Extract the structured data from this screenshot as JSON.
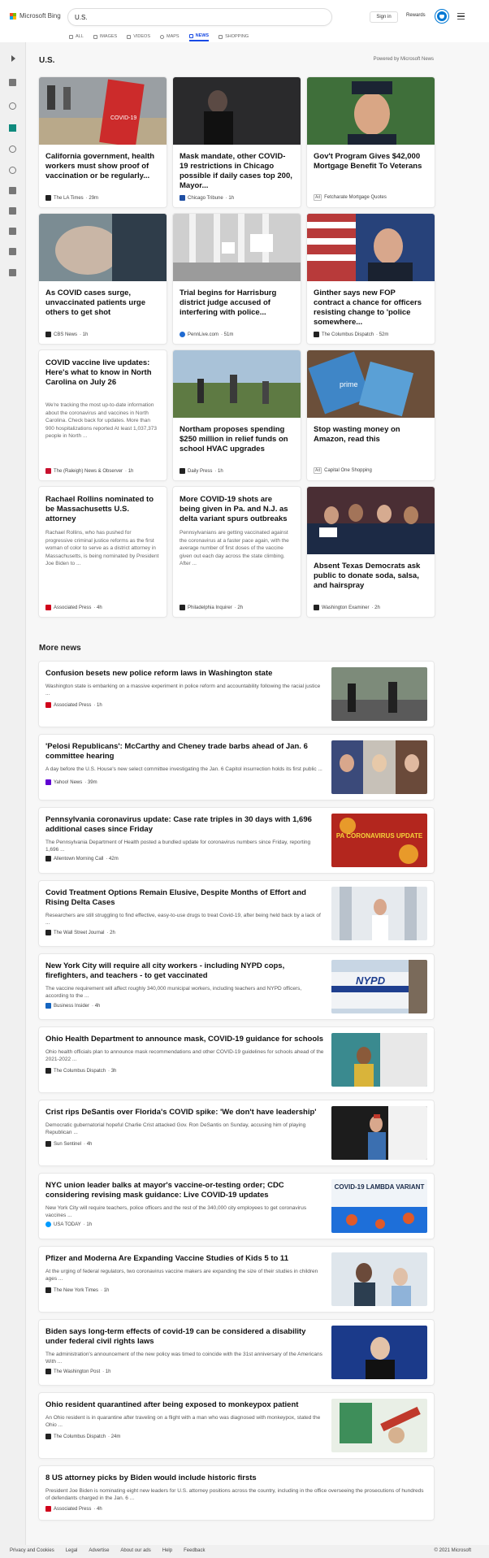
{
  "header": {
    "brand": "Microsoft Bing",
    "query": "U.S.",
    "signin": "Sign in",
    "rewards": "Rewards",
    "tabs": [
      {
        "label": "ALL",
        "icon": "search-icon"
      },
      {
        "label": "IMAGES",
        "icon": "image-icon"
      },
      {
        "label": "VIDEOS",
        "icon": "video-icon"
      },
      {
        "label": "MAPS",
        "icon": "map-pin-icon"
      },
      {
        "label": "NEWS",
        "icon": "news-icon",
        "active": true
      },
      {
        "label": "SHOPPING",
        "icon": "tag-icon"
      }
    ]
  },
  "section": {
    "title": "U.S.",
    "powered": "Powered by Microsoft News"
  },
  "cards": [
    {
      "title": "California government, health workers must show proof of vaccination or be regularly...",
      "source": "The LA Times",
      "time": "29m"
    },
    {
      "title": "Mask mandate, other COVID-19 restrictions in Chicago possible if daily cases top 200, Mayor...",
      "source": "Chicago Tribune",
      "time": "1h"
    },
    {
      "title": "Gov't Program Gives $42,000 Mortgage Benefit To Veterans",
      "source": "Fetcharate Mortgage Quotes",
      "ad": "Ad",
      "time": ""
    },
    {
      "title": "As COVID cases surge, unvaccinated patients urge others to get shot",
      "source": "CBS News",
      "time": "1h"
    },
    {
      "title": "Trial begins for Harrisburg district judge accused of interfering with police...",
      "source": "PennLive.com",
      "time": "51m"
    },
    {
      "title": "Ginther says new FOP contract a chance for officers resisting change to 'police somewhere...",
      "source": "The Columbus Dispatch",
      "time": "52m"
    },
    {
      "title": "COVID vaccine live updates: Here's what to know in North Carolina on July 26",
      "snippet": "We're tracking the most up-to-date information about the coronavirus and vaccines in North Carolina. Check back for updates. More than 900 hospitalizations reported At least 1,037,373 people in North ...",
      "source": "The (Raleigh) News & Observer",
      "time": "1h"
    },
    {
      "title": "Northam proposes spending $250 million in relief funds on school HVAC upgrades",
      "source": "Daily Press",
      "time": "1h"
    },
    {
      "title": "Stop wasting money on Amazon, read this",
      "source": "Capital One Shopping",
      "ad": "Ad",
      "time": ""
    },
    {
      "title": "Rachael Rollins nominated to be Massachusetts U.S. attorney",
      "snippet": "Rachael Rollins, who has pushed for progressive criminal justice reforms as the first woman of color to serve as a district attorney in Massachusetts, is being nominated by President Joe Biden to ...",
      "source": "Associated Press",
      "time": "4h"
    },
    {
      "title": "More COVID-19 shots are being given in Pa. and N.J. as delta variant spurs outbreaks",
      "snippet": "Pennsylvanians are getting vaccinated against the coronavirus at a faster pace again, with the average number of first doses of the vaccine given out each day across the state climbing. After ...",
      "source": "Philadelphia Inquirer",
      "time": "2h"
    },
    {
      "title": "Absent Texas Democrats ask public to donate soda, salsa, and hairspray",
      "source": "Washington Examiner",
      "time": "2h"
    }
  ],
  "more_news": {
    "title": "More news",
    "items": [
      {
        "title": "Confusion besets new police reform laws in Washington state",
        "snippet": "Washington state is embarking on a massive experiment in police reform and accountability following the racial justice ...",
        "source": "Associated Press",
        "time": "1h"
      },
      {
        "title": "'Pelosi Republicans': McCarthy and Cheney trade barbs ahead of Jan. 6 committee hearing",
        "snippet": "A day before the U.S. House's new select committee investigating the Jan. 6 Capitol insurrection holds its first public ...",
        "source": "Yahoo! News",
        "time": "39m"
      },
      {
        "title": "Pennsylvania coronavirus update: Case rate triples in 30 days with 1,696 additional cases since Friday",
        "snippet": "The Pennsylvania Department of Health posted a bundled update for coronavirus numbers since Friday, reporting 1,696 ...",
        "source": "Allentown Morning Call",
        "time": "42m",
        "img_text": "PA CORONAVIRUS UPDATE"
      },
      {
        "title": "Covid Treatment Options Remain Elusive, Despite Months of Effort and Rising Delta Cases",
        "snippet": "Researchers are still struggling to find effective, easy-to-use drugs to treat Covid-19, after being held back by a lack of ...",
        "source": "The Wall Street Journal",
        "time": "2h"
      },
      {
        "title": "New York City will require all city workers - including NYPD cops, firefighters, and teachers - to get vaccinated",
        "snippet": "The vaccine requirement will affect roughly 340,000 municipal workers, including teachers and NYPD officers, according to the ...",
        "source": "Business Insider",
        "time": "4h",
        "img_text": "NYPD"
      },
      {
        "title": "Ohio Health Department to announce mask, COVID-19 guidance for schools",
        "snippet": "Ohio health officials plan to announce mask recommendations and other COVID-19 guidelines for schools ahead of the 2021-2022 ...",
        "source": "The Columbus Dispatch",
        "time": "3h"
      },
      {
        "title": "Crist rips DeSantis over Florida's COVID spike: 'We don't have leadership'",
        "snippet": "Democratic gubernatorial hopeful Charlie Crist attacked Gov. Ron DeSantis on Sunday, accusing him of playing Republican ...",
        "source": "Sun Sentinel",
        "time": "4h"
      },
      {
        "title": "NYC union leader balks at mayor's vaccine-or-testing order; CDC considering revising mask guidance: Live COVID-19 updates",
        "snippet": "New York City will require teachers, police officers and the rest of the 340,000 city employees to get coronavirus vaccines ...",
        "source": "USA TODAY",
        "time": "1h",
        "img_text": "COVID-19 LAMBDA VARIANT"
      },
      {
        "title": "Pfizer and Moderna Are Expanding Vaccine Studies of Kids 5 to 11",
        "snippet": "At the urging of federal regulators, two coronavirus vaccine makers are expanding the size of their studies in children ages ...",
        "source": "The New York Times",
        "time": "1h"
      },
      {
        "title": "Biden says long-term effects of covid-19 can be considered a disability under federal civil rights laws",
        "snippet": "The administration's announcement of the new policy was timed to coincide with the 31st anniversary of the Americans With ...",
        "source": "The Washington Post",
        "time": "1h"
      },
      {
        "title": "Ohio resident quarantined after being exposed to monkeypox patient",
        "snippet": "An Ohio resident is in quarantine after traveling on a flight with a man who was diagnosed with monkeypox, stated the Ohio ...",
        "source": "The Columbus Dispatch",
        "time": "24m"
      },
      {
        "title": "8 US attorney picks by Biden would include historic firsts",
        "snippet": "President Joe Biden is nominating eight new leaders for U.S. attorney positions across the country, including in the office overseeing the prosecutions of hundreds of defendants charged in the Jan. 6 ...",
        "source": "Associated Press",
        "time": "4h"
      }
    ]
  },
  "footer": {
    "links": [
      "Privacy and Cookies",
      "Legal",
      "Advertise",
      "About our ads",
      "Help",
      "Feedback"
    ],
    "copyright": "© 2021 Microsoft"
  },
  "colors": {
    "accent": "#174ae4",
    "background": "#f7f7f7"
  }
}
